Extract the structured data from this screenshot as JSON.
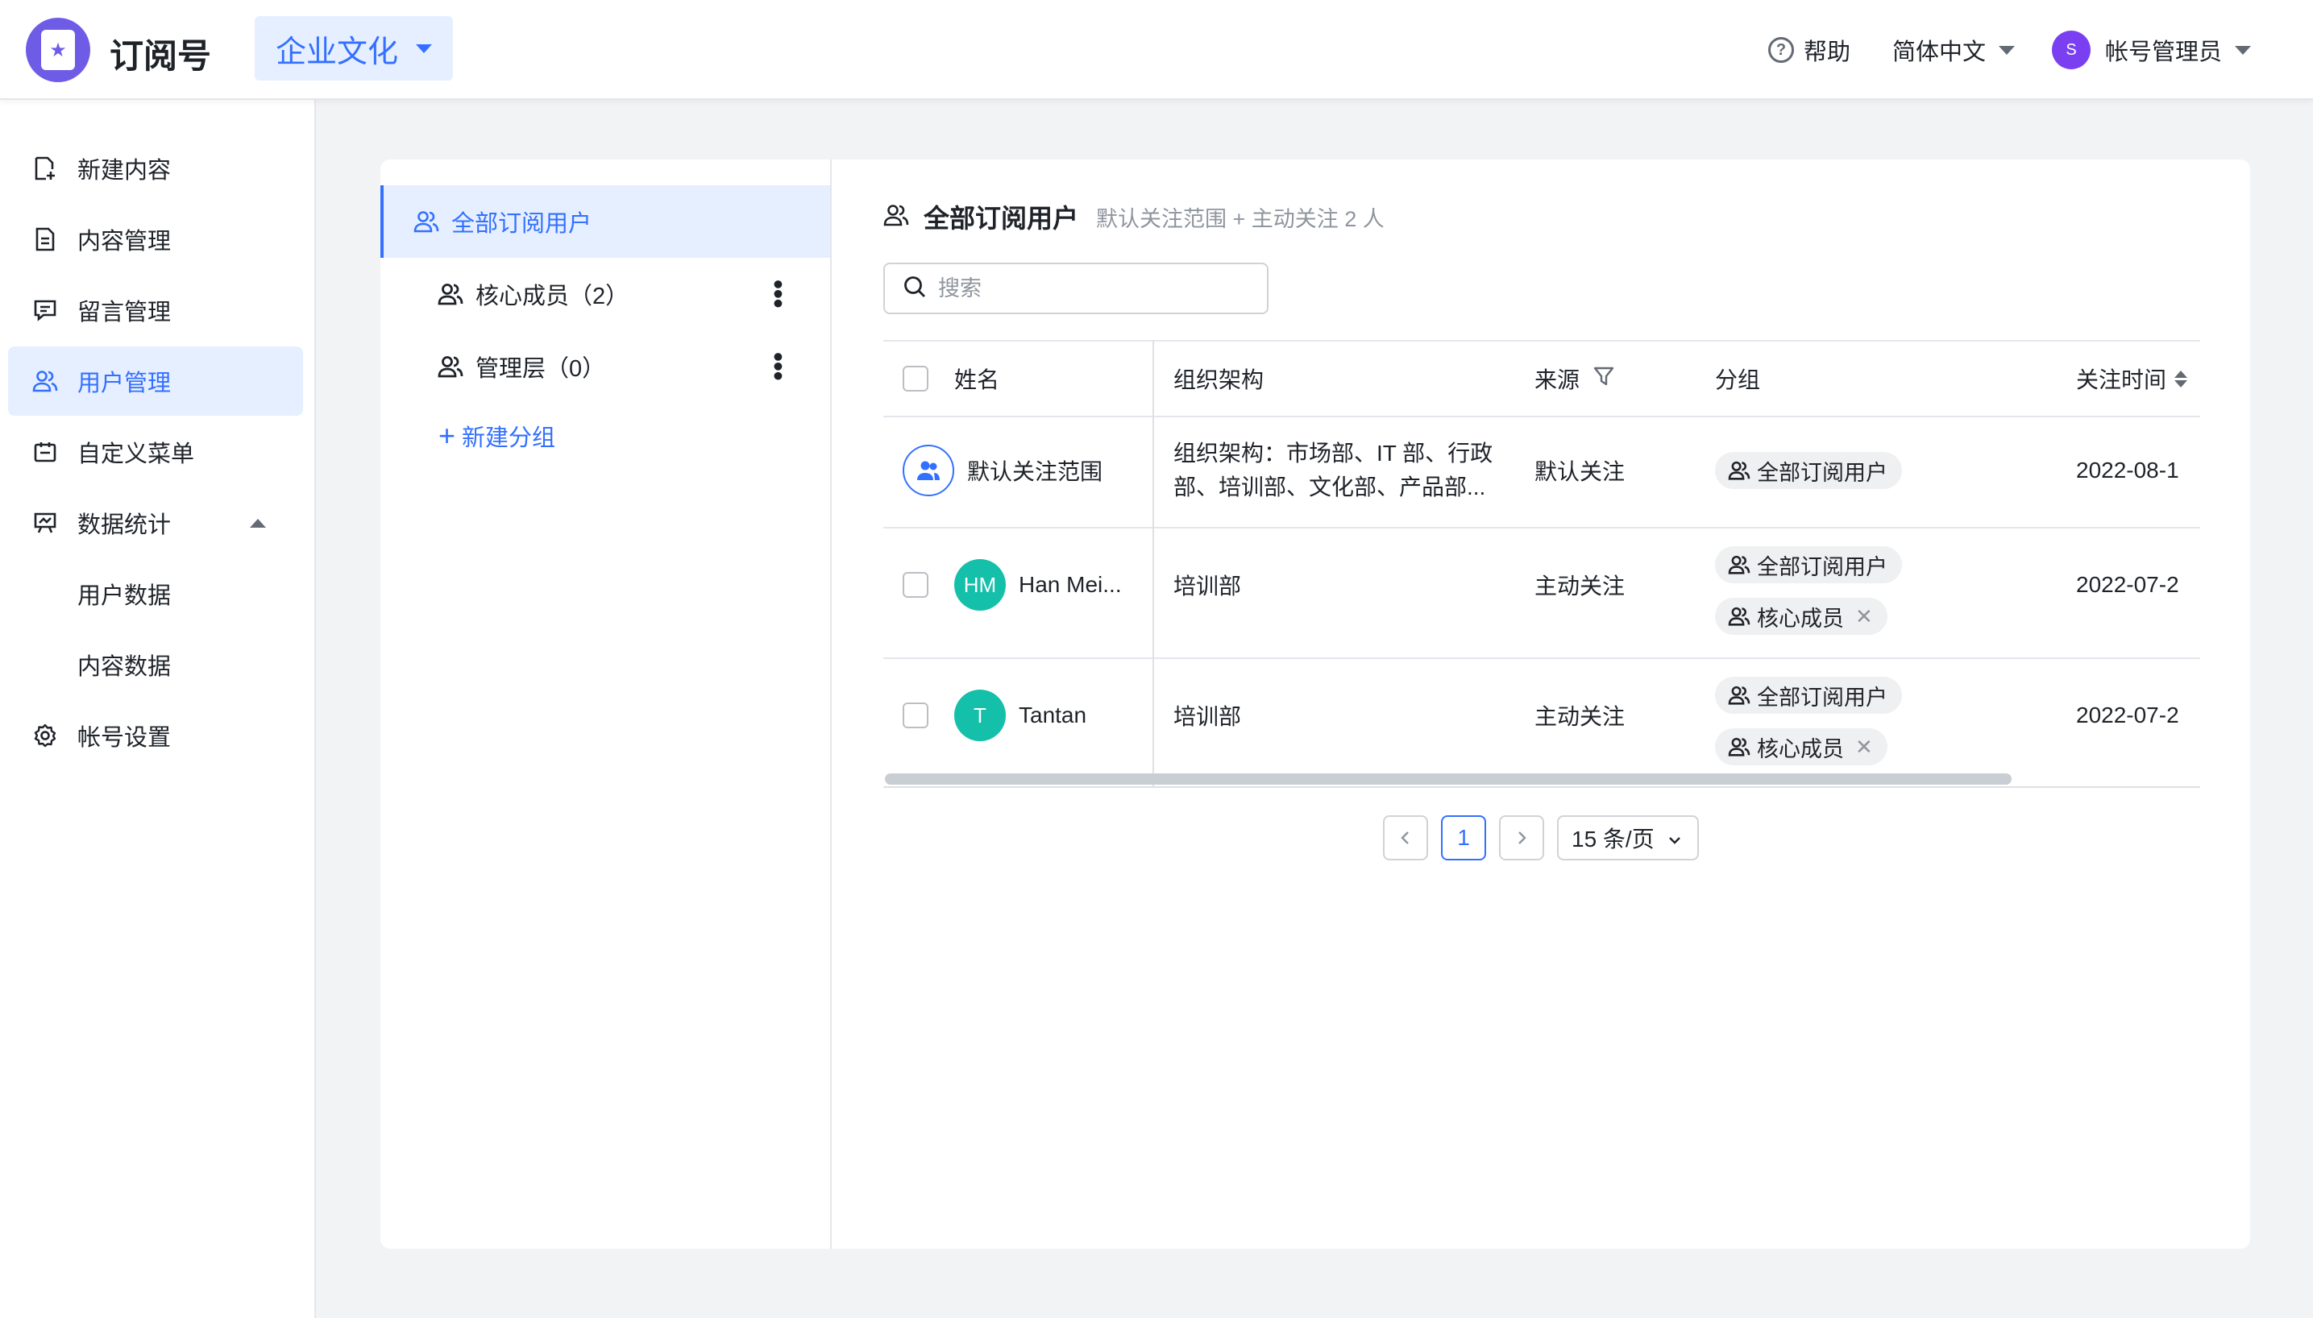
{
  "header": {
    "app_title": "订阅号",
    "account_name": "企业文化",
    "help_label": "帮助",
    "language_label": "简体中文",
    "user_avatar_letter": "S",
    "user_label": "帐号管理员",
    "accent_color": "#3370ff"
  },
  "nav": {
    "items": [
      {
        "label": "新建内容",
        "icon": "new-doc-icon"
      },
      {
        "label": "内容管理",
        "icon": "doc-icon"
      },
      {
        "label": "留言管理",
        "icon": "comment-icon"
      },
      {
        "label": "用户管理",
        "icon": "users-icon",
        "active": true
      },
      {
        "label": "自定义菜单",
        "icon": "menu-icon"
      },
      {
        "label": "数据统计",
        "icon": "chart-icon",
        "expanded": true
      },
      {
        "label": "用户数据",
        "sub": true
      },
      {
        "label": "内容数据",
        "sub": true
      },
      {
        "label": "帐号设置",
        "icon": "gear-icon"
      }
    ]
  },
  "groups": {
    "all": "全部订阅用户",
    "items": [
      {
        "label": "核心成员（2）"
      },
      {
        "label": "管理层（0）"
      }
    ],
    "new_group": "新建分组"
  },
  "content": {
    "title": "全部订阅用户",
    "subtitle": "默认关注范围 + 主动关注 2 人",
    "search_placeholder": "搜索",
    "columns": {
      "name": "姓名",
      "org": "组织架构",
      "source": "来源",
      "group": "分组",
      "follow_time": "关注时间"
    },
    "rows": [
      {
        "name": "默认关注范围",
        "org_line1": "组织架构：市场部、IT 部、行政",
        "org_line2": "部、培训部、文化部、产品部...",
        "source": "默认关注",
        "tags": [
          "全部订阅用户"
        ],
        "time": "2022-08-1"
      },
      {
        "avatar": "HM",
        "name": "Han Mei...",
        "org": "培训部",
        "source": "主动关注",
        "tags": [
          "全部订阅用户",
          "核心成员"
        ],
        "time": "2022-07-2"
      },
      {
        "avatar": "T",
        "name": "Tantan",
        "org": "培训部",
        "source": "主动关注",
        "tags": [
          "全部订阅用户",
          "核心成员"
        ],
        "time": "2022-07-2"
      }
    ],
    "pagination": {
      "current_page": "1",
      "page_size": "15 条/页"
    }
  }
}
